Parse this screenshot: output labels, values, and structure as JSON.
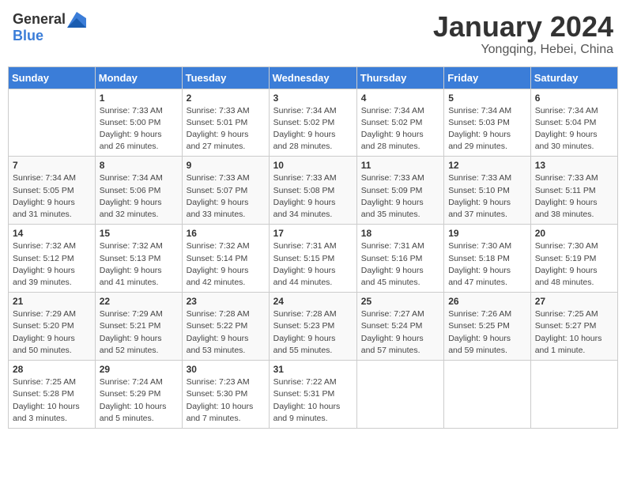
{
  "header": {
    "logo": {
      "general": "General",
      "blue": "Blue"
    },
    "title": "January 2024",
    "subtitle": "Yongqing, Hebei, China"
  },
  "weekdays": [
    "Sunday",
    "Monday",
    "Tuesday",
    "Wednesday",
    "Thursday",
    "Friday",
    "Saturday"
  ],
  "weeks": [
    [
      {
        "num": "",
        "info": ""
      },
      {
        "num": "1",
        "info": "Sunrise: 7:33 AM\nSunset: 5:00 PM\nDaylight: 9 hours\nand 26 minutes."
      },
      {
        "num": "2",
        "info": "Sunrise: 7:33 AM\nSunset: 5:01 PM\nDaylight: 9 hours\nand 27 minutes."
      },
      {
        "num": "3",
        "info": "Sunrise: 7:34 AM\nSunset: 5:02 PM\nDaylight: 9 hours\nand 28 minutes."
      },
      {
        "num": "4",
        "info": "Sunrise: 7:34 AM\nSunset: 5:02 PM\nDaylight: 9 hours\nand 28 minutes."
      },
      {
        "num": "5",
        "info": "Sunrise: 7:34 AM\nSunset: 5:03 PM\nDaylight: 9 hours\nand 29 minutes."
      },
      {
        "num": "6",
        "info": "Sunrise: 7:34 AM\nSunset: 5:04 PM\nDaylight: 9 hours\nand 30 minutes."
      }
    ],
    [
      {
        "num": "7",
        "info": "Sunrise: 7:34 AM\nSunset: 5:05 PM\nDaylight: 9 hours\nand 31 minutes."
      },
      {
        "num": "8",
        "info": "Sunrise: 7:34 AM\nSunset: 5:06 PM\nDaylight: 9 hours\nand 32 minutes."
      },
      {
        "num": "9",
        "info": "Sunrise: 7:33 AM\nSunset: 5:07 PM\nDaylight: 9 hours\nand 33 minutes."
      },
      {
        "num": "10",
        "info": "Sunrise: 7:33 AM\nSunset: 5:08 PM\nDaylight: 9 hours\nand 34 minutes."
      },
      {
        "num": "11",
        "info": "Sunrise: 7:33 AM\nSunset: 5:09 PM\nDaylight: 9 hours\nand 35 minutes."
      },
      {
        "num": "12",
        "info": "Sunrise: 7:33 AM\nSunset: 5:10 PM\nDaylight: 9 hours\nand 37 minutes."
      },
      {
        "num": "13",
        "info": "Sunrise: 7:33 AM\nSunset: 5:11 PM\nDaylight: 9 hours\nand 38 minutes."
      }
    ],
    [
      {
        "num": "14",
        "info": "Sunrise: 7:32 AM\nSunset: 5:12 PM\nDaylight: 9 hours\nand 39 minutes."
      },
      {
        "num": "15",
        "info": "Sunrise: 7:32 AM\nSunset: 5:13 PM\nDaylight: 9 hours\nand 41 minutes."
      },
      {
        "num": "16",
        "info": "Sunrise: 7:32 AM\nSunset: 5:14 PM\nDaylight: 9 hours\nand 42 minutes."
      },
      {
        "num": "17",
        "info": "Sunrise: 7:31 AM\nSunset: 5:15 PM\nDaylight: 9 hours\nand 44 minutes."
      },
      {
        "num": "18",
        "info": "Sunrise: 7:31 AM\nSunset: 5:16 PM\nDaylight: 9 hours\nand 45 minutes."
      },
      {
        "num": "19",
        "info": "Sunrise: 7:30 AM\nSunset: 5:18 PM\nDaylight: 9 hours\nand 47 minutes."
      },
      {
        "num": "20",
        "info": "Sunrise: 7:30 AM\nSunset: 5:19 PM\nDaylight: 9 hours\nand 48 minutes."
      }
    ],
    [
      {
        "num": "21",
        "info": "Sunrise: 7:29 AM\nSunset: 5:20 PM\nDaylight: 9 hours\nand 50 minutes."
      },
      {
        "num": "22",
        "info": "Sunrise: 7:29 AM\nSunset: 5:21 PM\nDaylight: 9 hours\nand 52 minutes."
      },
      {
        "num": "23",
        "info": "Sunrise: 7:28 AM\nSunset: 5:22 PM\nDaylight: 9 hours\nand 53 minutes."
      },
      {
        "num": "24",
        "info": "Sunrise: 7:28 AM\nSunset: 5:23 PM\nDaylight: 9 hours\nand 55 minutes."
      },
      {
        "num": "25",
        "info": "Sunrise: 7:27 AM\nSunset: 5:24 PM\nDaylight: 9 hours\nand 57 minutes."
      },
      {
        "num": "26",
        "info": "Sunrise: 7:26 AM\nSunset: 5:25 PM\nDaylight: 9 hours\nand 59 minutes."
      },
      {
        "num": "27",
        "info": "Sunrise: 7:25 AM\nSunset: 5:27 PM\nDaylight: 10 hours\nand 1 minute."
      }
    ],
    [
      {
        "num": "28",
        "info": "Sunrise: 7:25 AM\nSunset: 5:28 PM\nDaylight: 10 hours\nand 3 minutes."
      },
      {
        "num": "29",
        "info": "Sunrise: 7:24 AM\nSunset: 5:29 PM\nDaylight: 10 hours\nand 5 minutes."
      },
      {
        "num": "30",
        "info": "Sunrise: 7:23 AM\nSunset: 5:30 PM\nDaylight: 10 hours\nand 7 minutes."
      },
      {
        "num": "31",
        "info": "Sunrise: 7:22 AM\nSunset: 5:31 PM\nDaylight: 10 hours\nand 9 minutes."
      },
      {
        "num": "",
        "info": ""
      },
      {
        "num": "",
        "info": ""
      },
      {
        "num": "",
        "info": ""
      }
    ]
  ]
}
